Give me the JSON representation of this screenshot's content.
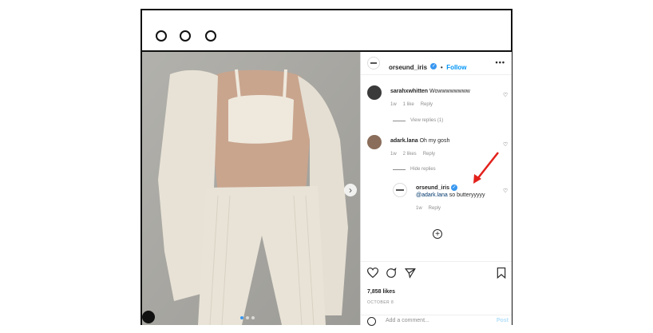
{
  "window": {
    "controls": [
      "circle-1",
      "circle-2",
      "circle-3"
    ]
  },
  "post": {
    "username": "orseund_iris",
    "follow_label": "Follow",
    "separator": "•",
    "more_label": "•••",
    "likes": "7,858 likes",
    "date": "OCTOBER 8",
    "comment_placeholder": "Add a comment...",
    "post_label": "Post",
    "carousel": {
      "slides": 3,
      "active": 0
    }
  },
  "comments": [
    {
      "username": "sarahxwhitten",
      "text": "Wowwwwwwww",
      "time": "1w",
      "likes": "1 like",
      "reply_label": "Reply",
      "replies_toggle": "View replies (1)"
    },
    {
      "username": "adark.lana",
      "text": "Oh my gosh",
      "time": "1w",
      "likes": "2 likes",
      "reply_label": "Reply",
      "replies_toggle": "Hide replies"
    }
  ],
  "reply": {
    "username": "orseund_iris",
    "mention": "@adark.lana",
    "text": " so butteryyyyy",
    "time": "1w",
    "reply_label": "Reply"
  },
  "colors": {
    "accent": "#0095f6",
    "verified": "#3897f0",
    "arrow": "#e3201b"
  }
}
